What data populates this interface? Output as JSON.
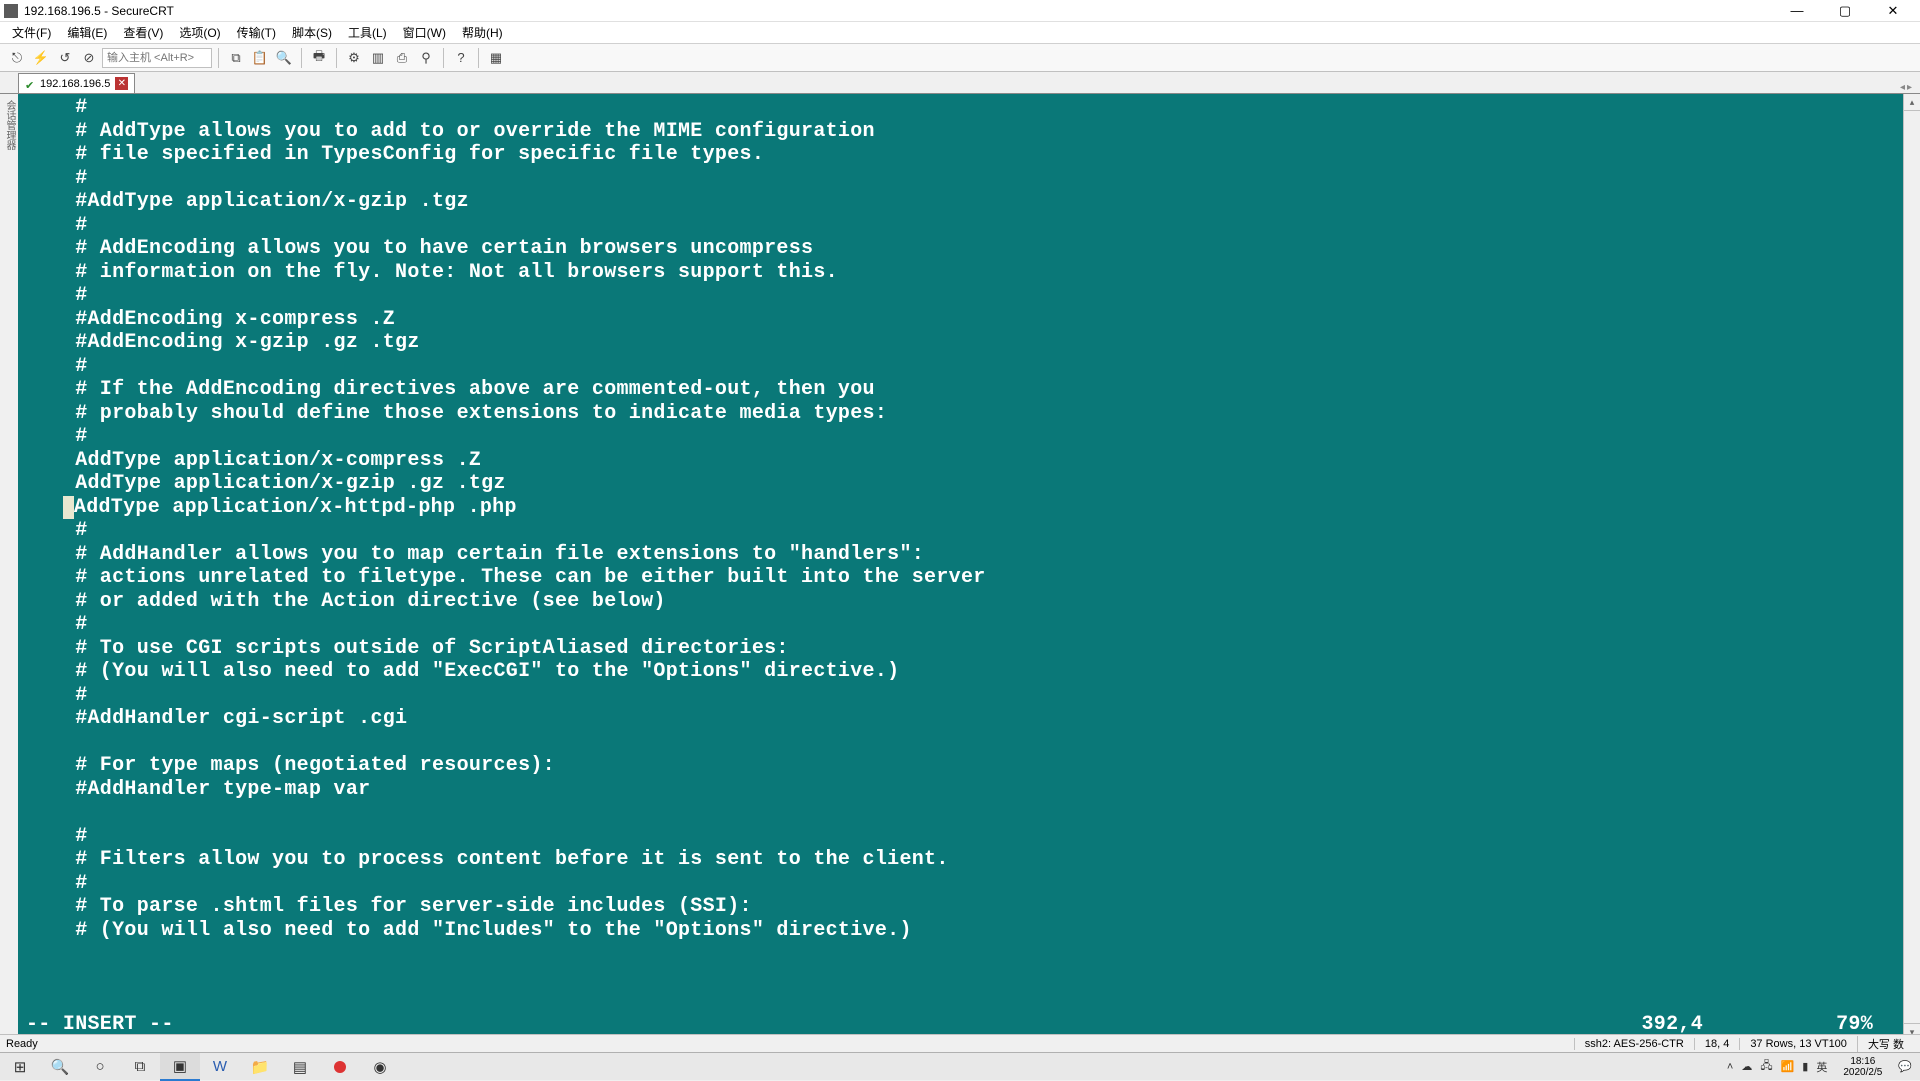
{
  "window": {
    "title": "192.168.196.5 - SecureCRT"
  },
  "menu": {
    "file": "文件(F)",
    "edit": "编辑(E)",
    "view": "查看(V)",
    "options": "选项(O)",
    "transfer": "传输(T)",
    "script": "脚本(S)",
    "tools": "工具(L)",
    "window": "窗口(W)",
    "help": "帮助(H)"
  },
  "toolbar": {
    "host_placeholder": "输入主机 <Alt+R>"
  },
  "tab": {
    "label": "192.168.196.5"
  },
  "terminal": {
    "lines": [
      "    #",
      "    # AddType allows you to add to or override the MIME configuration",
      "    # file specified in TypesConfig for specific file types.",
      "    #",
      "    #AddType application/x-gzip .tgz",
      "    #",
      "    # AddEncoding allows you to have certain browsers uncompress",
      "    # information on the fly. Note: Not all browsers support this.",
      "    #",
      "    #AddEncoding x-compress .Z",
      "    #AddEncoding x-gzip .gz .tgz",
      "    #",
      "    # If the AddEncoding directives above are commented-out, then you",
      "    # probably should define those extensions to indicate media types:",
      "    #",
      "    AddType application/x-compress .Z",
      "    AddType application/x-gzip .gz .tgz",
      "   AddType application/x-httpd-php .php",
      "    #",
      "    # AddHandler allows you to map certain file extensions to \"handlers\":",
      "    # actions unrelated to filetype. These can be either built into the server",
      "    # or added with the Action directive (see below)",
      "    #",
      "    # To use CGI scripts outside of ScriptAliased directories:",
      "    # (You will also need to add \"ExecCGI\" to the \"Options\" directive.)",
      "    #",
      "    #AddHandler cgi-script .cgi",
      "",
      "    # For type maps (negotiated resources):",
      "    #AddHandler type-map var",
      "",
      "    #",
      "    # Filters allow you to process content before it is sent to the client.",
      "    #",
      "    # To parse .shtml files for server-side includes (SSI):",
      "    # (You will also need to add \"Includes\" to the \"Options\" directive.)"
    ],
    "vim_mode": "-- INSERT --",
    "vim_pos": "392,4",
    "vim_pct": "79%",
    "cursor_line_index": 17
  },
  "status": {
    "ready": "Ready",
    "proto": "ssh2: AES-256-CTR",
    "coord": "18,  4",
    "size": "37 Rows, 13 VT100",
    "caps": "大写 数"
  },
  "tray": {
    "ime": "英",
    "time": "18:16",
    "date": "2020/2/5"
  },
  "sidebar_label": "会话管理器"
}
